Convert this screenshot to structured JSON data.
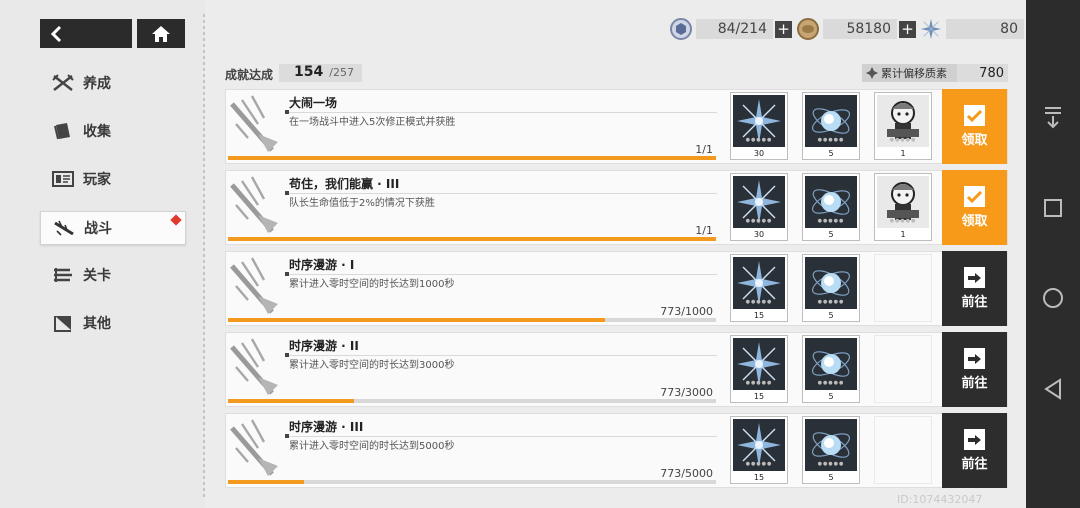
{
  "nav": {
    "items": [
      {
        "label": "养成",
        "icon": "crossed-swords-icon"
      },
      {
        "label": "收集",
        "icon": "book-icon"
      },
      {
        "label": "玩家",
        "icon": "id-card-icon"
      },
      {
        "label": "战斗",
        "icon": "rifle-icon",
        "active": true
      },
      {
        "label": "关卡",
        "icon": "map-icon"
      },
      {
        "label": "其他",
        "icon": "flag-icon"
      }
    ]
  },
  "currencies": [
    {
      "name": "stamina",
      "value": "84/214"
    },
    {
      "name": "coin",
      "value": "58180"
    },
    {
      "name": "crystal",
      "value": "80"
    }
  ],
  "achievement": {
    "label": "成就达成",
    "count": "154",
    "total": "/257"
  },
  "offset": {
    "label": "累计偏移质素",
    "value": "780"
  },
  "tasks": [
    {
      "title": "大闹一场",
      "desc": "在一场战斗中进入5次修正模式并获胜",
      "progress": "1/1",
      "fraction": 1.0,
      "rewards": [
        "30",
        "5",
        "1"
      ],
      "reward_types": [
        "crystal",
        "orb",
        "chibi"
      ],
      "action": "领取",
      "action_type": "claim"
    },
    {
      "title": "苟住，我们能赢 · III",
      "desc": "队长生命值低于2%的情况下获胜",
      "progress": "1/1",
      "fraction": 1.0,
      "rewards": [
        "30",
        "5",
        "1"
      ],
      "reward_types": [
        "crystal",
        "orb",
        "chibi"
      ],
      "action": "领取",
      "action_type": "claim"
    },
    {
      "title": "时序漫游 · I",
      "desc": "累计进入零时空间的时长达到1000秒",
      "progress": "773/1000",
      "fraction": 0.773,
      "rewards": [
        "15",
        "5"
      ],
      "reward_types": [
        "crystal",
        "orb"
      ],
      "action": "前往",
      "action_type": "go"
    },
    {
      "title": "时序漫游 · II",
      "desc": "累计进入零时空间的时长达到3000秒",
      "progress": "773/3000",
      "fraction": 0.258,
      "rewards": [
        "15",
        "5"
      ],
      "reward_types": [
        "crystal",
        "orb"
      ],
      "action": "前往",
      "action_type": "go"
    },
    {
      "title": "时序漫游 · III",
      "desc": "累计进入零时空间的时长达到5000秒",
      "progress": "773/5000",
      "fraction": 0.155,
      "rewards": [
        "15",
        "5"
      ],
      "reward_types": [
        "crystal",
        "orb"
      ],
      "action": "前往",
      "action_type": "go"
    }
  ],
  "uid": "ID:1074432047",
  "colors": {
    "accent": "#f79a1a",
    "dark": "#2d2d2d",
    "badge": "#e03a2f"
  }
}
